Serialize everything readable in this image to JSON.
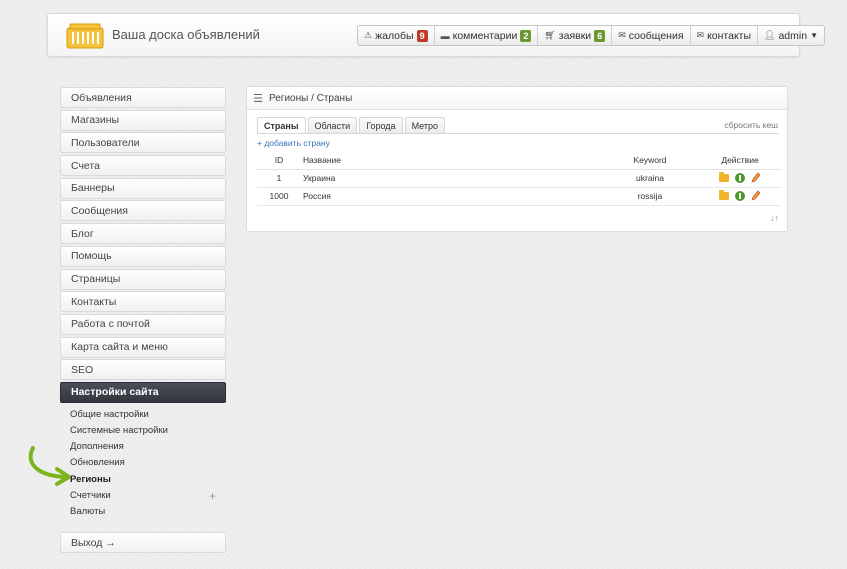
{
  "header": {
    "site_title": "Ваша доска объявлений",
    "nav": [
      {
        "label": "жалобы",
        "badge": "9",
        "badge_color": "#c0392b",
        "icon": "warning-icon"
      },
      {
        "label": "комментарии",
        "badge": "2",
        "badge_color": "#6a9a2e",
        "icon": "comment-icon"
      },
      {
        "label": "заявки",
        "badge": "6",
        "badge_color": "#6a9a2e",
        "icon": "cart-icon"
      },
      {
        "label": "сообщения",
        "icon": "envelope-icon"
      },
      {
        "label": "контакты",
        "icon": "envelope-icon"
      },
      {
        "label": "admin",
        "icon": "user-icon"
      }
    ]
  },
  "sidebar": {
    "items": [
      {
        "label": "Объявления"
      },
      {
        "label": "Магазины"
      },
      {
        "label": "Пользователи"
      },
      {
        "label": "Счета"
      },
      {
        "label": "Баннеры"
      },
      {
        "label": "Сообщения"
      },
      {
        "label": "Блог"
      },
      {
        "label": "Помощь"
      },
      {
        "label": "Страницы"
      },
      {
        "label": "Контакты"
      },
      {
        "label": "Работа с почтой"
      },
      {
        "label": "Карта сайта и меню"
      },
      {
        "label": "SEO"
      },
      {
        "label": "Настройки сайта"
      }
    ],
    "sub_items": [
      {
        "label": "Общие настройки"
      },
      {
        "label": "Системные настройки"
      },
      {
        "label": "Дополнения"
      },
      {
        "label": "Обновления"
      },
      {
        "label": "Регионы"
      },
      {
        "label": "Счетчики"
      },
      {
        "label": "Валюты"
      }
    ],
    "logout_label": "Выход →"
  },
  "main": {
    "breadcrumb": "Регионы / Страны",
    "tabs": [
      {
        "label": "Страны"
      },
      {
        "label": "Области"
      },
      {
        "label": "Города"
      },
      {
        "label": "Метро"
      }
    ],
    "reset_cache": "сбросить кеш",
    "add_country": "+ добавить страну",
    "table": {
      "headers": {
        "id": "ID",
        "name": "Название",
        "keyword": "Keyword",
        "action": "Действие"
      },
      "rows": [
        {
          "id": "1",
          "name": "Украина",
          "keyword": "ukraina"
        },
        {
          "id": "1000",
          "name": "Россия",
          "keyword": "rossija"
        }
      ]
    },
    "sort_icon": "↓↑"
  },
  "colors": {
    "accent": "#3a73b8",
    "active_nav": "#3a3d45",
    "arrow": "#7ab51d"
  }
}
